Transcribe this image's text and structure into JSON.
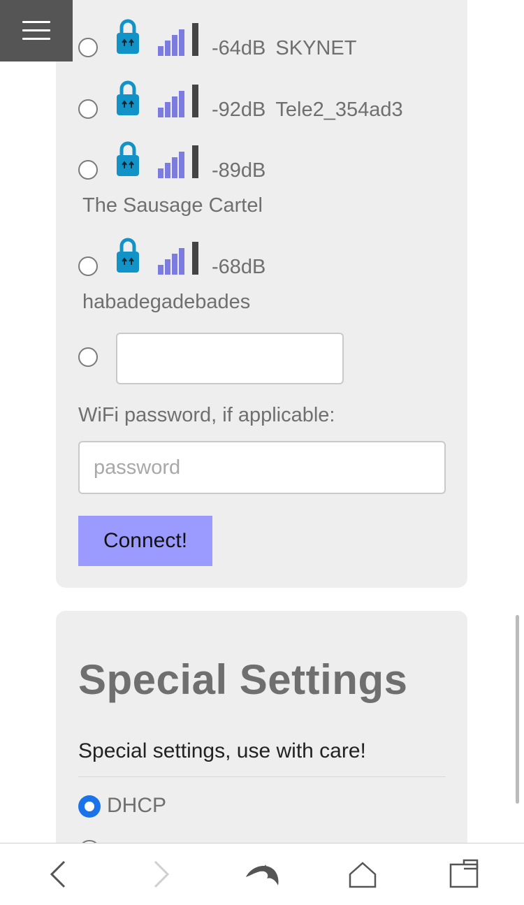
{
  "menu": {
    "icon": "hamburger-menu-icon"
  },
  "wifi": {
    "networks": [
      {
        "signal": "-64dB",
        "ssid": "SKYNET",
        "locked": true,
        "signal_icon": "signal-bars-icon"
      },
      {
        "signal": "-92dB",
        "ssid": "Tele2_354ad3",
        "locked": true,
        "signal_icon": "signal-bars-icon"
      },
      {
        "signal": "-89dB",
        "ssid": "The Sausage Cartel",
        "locked": true,
        "signal_icon": "signal-bars-icon"
      },
      {
        "signal": "-68dB",
        "ssid": "habadegadebades",
        "locked": true,
        "signal_icon": "signal-bars-icon"
      }
    ],
    "custom_ssid_value": "",
    "password_label": "WiFi password, if applicable:",
    "password_placeholder": "password",
    "password_value": "",
    "connect_label": "Connect!"
  },
  "special": {
    "title": "Special Settings",
    "description": "Special settings, use with care!",
    "dhcp_label": "DHCP",
    "dhcp_selected": true
  },
  "browser_nav": {
    "items": [
      "back-icon",
      "forward-icon",
      "dolphin-logo-icon",
      "home-icon",
      "tabs-icon"
    ]
  },
  "colors": {
    "card_bg": "#eeeeee",
    "connect_button": "#9a9aff",
    "lock": "#1193c8",
    "signal_bars": "#7b7be0",
    "radio_selected": "#1a73e8"
  }
}
